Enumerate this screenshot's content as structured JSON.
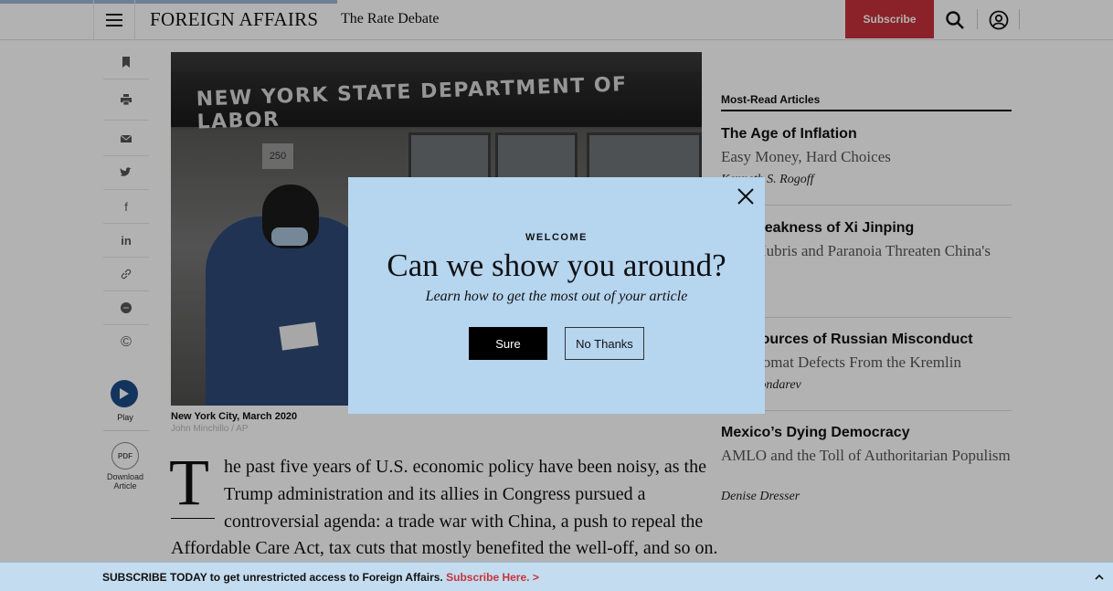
{
  "header": {
    "logo": "FOREIGN AFFAIRS",
    "issue_title": "The Rate Debate",
    "subscribe_label": "Subscribe",
    "brand_red": "#c8323c"
  },
  "rail": {
    "icons": [
      "bookmark-icon",
      "print-icon",
      "email-icon",
      "twitter-icon",
      "facebook-icon",
      "linkedin-icon",
      "link-icon",
      "comment-icon",
      "copyright-icon"
    ],
    "facebook_glyph": "f",
    "linkedin_glyph": "in",
    "copyright_glyph": "©",
    "play_label": "Play",
    "pdf_glyph": "PDF",
    "download_label_1": "Download",
    "download_label_2": "Article"
  },
  "photo": {
    "sign_text": "NEW YORK STATE DEPARTMENT OF LABOR",
    "address_number": "250",
    "caption": "New York City, March 2020",
    "credit": "John Minchillo / AP"
  },
  "article": {
    "dropcap": "T",
    "lines": [
      "he past five years of U.S. economic policy have been noisy, as the",
      "Trump administration and its allies in Congress pursued a",
      "controversial agenda: a trade war with China, a push to repeal the",
      "Affordable Care Act, tax cuts that mostly benefited the well-off, and so on."
    ]
  },
  "most_read": {
    "heading": "Most-Read Articles",
    "items": [
      {
        "title": "The Age of Inflation",
        "subtitle": "Easy Money, Hard Choices",
        "author": "Kenneth S. Rogoff"
      },
      {
        "title": "The Weakness of Xi Jinping",
        "subtitle": "How Hubris and Paranoia Threaten China's",
        "author": ""
      },
      {
        "title": "The Sources of Russian Misconduct",
        "subtitle": "A Diplomat Defects From the Kremlin",
        "author": "Boris Bondarev"
      },
      {
        "title": "Mexico’s Dying Democracy",
        "subtitle": "AMLO and the Toll of Authoritarian Populism",
        "author": "Denise Dresser"
      }
    ]
  },
  "modal": {
    "kicker": "WELCOME",
    "title": "Can we show you around?",
    "subtitle": "Learn how to get the most out of your article",
    "sure_label": "Sure",
    "no_thanks_label": "No Thanks",
    "background": "#b6d5ef"
  },
  "subscribe_bar": {
    "text": "SUBSCRIBE TODAY to get unrestricted access to Foreign Affairs.",
    "link": "Subscribe Here. >"
  }
}
